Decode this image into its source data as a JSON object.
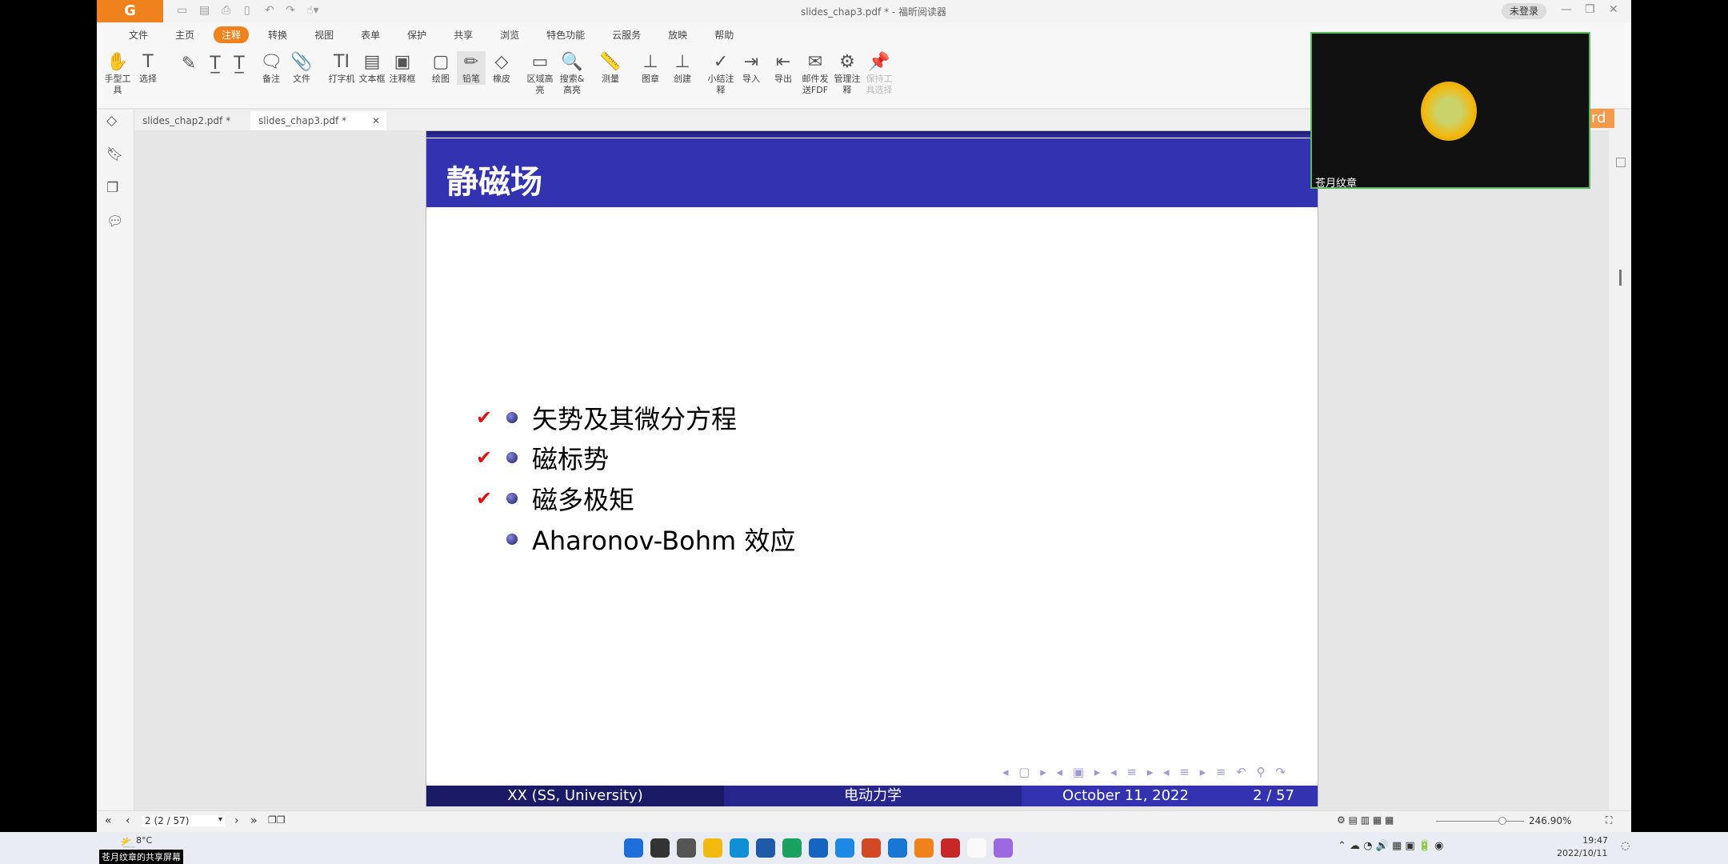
{
  "app": {
    "title": "slides_chap3.pdf * - 福昕阅读器",
    "logo": "G",
    "login": "未登录",
    "minimize": "—",
    "restore": "❐",
    "close": "✕"
  },
  "menu": [
    "文件",
    "主页",
    "注释",
    "转换",
    "视图",
    "表单",
    "保护",
    "共享",
    "浏览",
    "特色功能",
    "云服务",
    "放映",
    "帮助"
  ],
  "active_menu": "注释",
  "ribbon": [
    {
      "label": "手型工具",
      "icon": "✋"
    },
    {
      "label": "选择",
      "icon": "T"
    },
    {
      "label": "",
      "icon": "✎"
    },
    {
      "label": "",
      "icon": "T̲"
    },
    {
      "label": "",
      "icon": "T̲"
    },
    {
      "label": "备注",
      "icon": "🗨"
    },
    {
      "label": "文件",
      "icon": "📎"
    },
    {
      "label": "打字机",
      "icon": "TI"
    },
    {
      "label": "文本框",
      "icon": "▤"
    },
    {
      "label": "注释框",
      "icon": "▣"
    },
    {
      "label": "绘图",
      "icon": "▢"
    },
    {
      "label": "铅笔",
      "icon": "✏"
    },
    {
      "label": "橡皮",
      "icon": "◇"
    },
    {
      "label": "区域高亮",
      "icon": "▭"
    },
    {
      "label": "搜索&高亮",
      "icon": "🔍"
    },
    {
      "label": "测量",
      "icon": "📏"
    },
    {
      "label": "图章",
      "icon": "⊥"
    },
    {
      "label": "创建",
      "icon": "⊥"
    },
    {
      "label": "小结注释",
      "icon": "✓"
    },
    {
      "label": "导入",
      "icon": "⇥"
    },
    {
      "label": "导出",
      "icon": "⇤"
    },
    {
      "label": "邮件发送FDF",
      "icon": "✉"
    },
    {
      "label": "管理注释",
      "icon": "⚙"
    },
    {
      "label": "保持工具选择",
      "icon": "📌"
    }
  ],
  "tabs": [
    {
      "label": "slides_chap2.pdf *"
    },
    {
      "label": "slides_chap3.pdf *",
      "close": "✕"
    }
  ],
  "slide": {
    "title": "静磁场",
    "bullets": [
      {
        "text": "矢势及其微分方程",
        "checked": true
      },
      {
        "text": "磁标势",
        "checked": true
      },
      {
        "text": "磁多极矩",
        "checked": true
      },
      {
        "text": "Aharonov-Bohm 效应",
        "checked": false
      }
    ],
    "nav": "◂ ▢ ▸ ◂ ▣ ▸ ◂ ≡ ▸ ◂ ≡ ▸ ≡ ↶ ⚲ ↷",
    "footer": {
      "author": "XX (SS, University)",
      "course": "电动力学",
      "date": "October 11, 2022",
      "page": "2 / 57"
    },
    "colors": {
      "header": "#3333b2",
      "footer_left": "#1a1a66",
      "footer_mid": "#26268c",
      "footer_right": "#3333b2",
      "check": "#e01010"
    }
  },
  "statusbar": {
    "page_input": "2 (2 / 57)",
    "zoom": "246.90%",
    "zoom_fraction": 0.7
  },
  "video": {
    "name": "苍月纹章"
  },
  "overlay_text": "ord",
  "taskbar": {
    "weather": "8°C",
    "share_label": "苍月纹章的共享屏幕",
    "time": "19:47",
    "date": "2022/10/11"
  }
}
